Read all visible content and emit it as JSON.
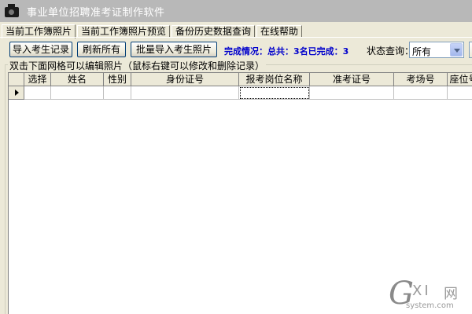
{
  "window": {
    "title": "事业单位招聘准考证制作软件",
    "icon": "camera-icon"
  },
  "tabs": [
    {
      "label": "当前工作簿照片",
      "active": true
    },
    {
      "label": "当前工作簿照片预览",
      "active": false
    },
    {
      "label": "备份历史数据查询",
      "active": false
    },
    {
      "label": "在线帮助",
      "active": false
    }
  ],
  "toolbar": {
    "import_records_label": "导入考生记录",
    "refresh_all_label": "刷新所有",
    "batch_import_photos_label": "批量导入考生照片",
    "status_text": "完成情况：总共：3名已完成：3",
    "filter_label": "状态查询：",
    "filter_value": "所有"
  },
  "group": {
    "label": "双击下面网格可以编辑照片（鼠标右键可以修改和删除记录）"
  },
  "grid": {
    "columns": [
      "选择",
      "姓名",
      "性别",
      "身份证号",
      "报考岗位名称",
      "准考证号",
      "考场号",
      "座位号"
    ],
    "rows": [
      [
        "",
        "",
        "",
        "",
        "",
        "",
        "",
        ""
      ]
    ]
  },
  "watermark": {
    "logo_letter": "G",
    "logo_xi": "XI",
    "logo_net": "网",
    "url": "system.com"
  }
}
